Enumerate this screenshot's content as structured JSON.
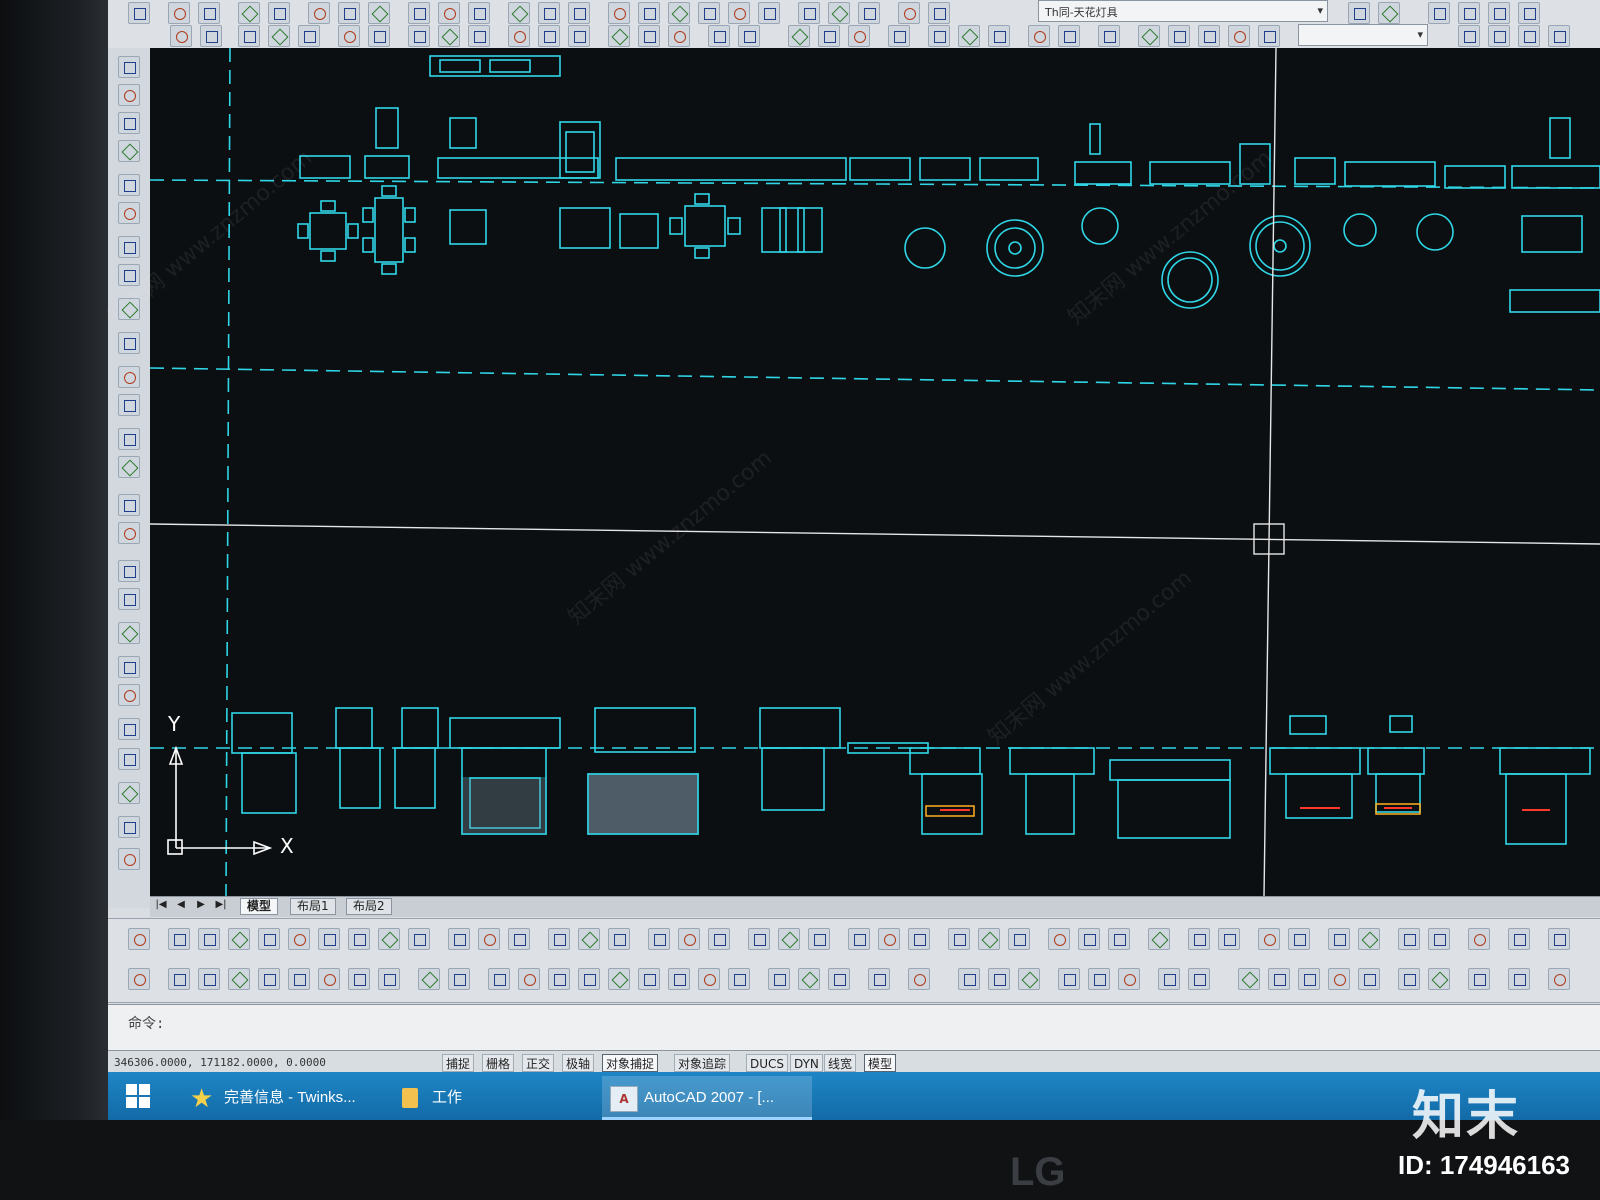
{
  "top_toolbar": {
    "layer_combo_text": "Th同-天花灯具"
  },
  "layout_tabs": {
    "nav_first": "|◀",
    "nav_prev": "◀",
    "nav_next": "▶",
    "nav_last": "▶|",
    "items": [
      {
        "label": "模型"
      },
      {
        "label": "布局1"
      },
      {
        "label": "布局2"
      }
    ]
  },
  "ucs": {
    "y_label": "Y",
    "x_label": "X"
  },
  "command": {
    "prompt": "命令:"
  },
  "status_bar": {
    "coordinates": "346306.0000, 171182.0000, 0.0000",
    "buttons": [
      {
        "label": "捕捉",
        "on": false
      },
      {
        "label": "栅格",
        "on": false
      },
      {
        "label": "正交",
        "on": false
      },
      {
        "label": "极轴",
        "on": false
      },
      {
        "label": "对象捕捉",
        "on": true
      },
      {
        "label": "对象追踪",
        "on": false
      },
      {
        "label": "DUCS",
        "on": false
      },
      {
        "label": "DYN",
        "on": false
      },
      {
        "label": "线宽",
        "on": false
      },
      {
        "label": "模型",
        "on": true
      }
    ]
  },
  "taskbar": {
    "items": [
      {
        "label": "完善信息 - Twinks..."
      },
      {
        "label": "工作"
      },
      {
        "label": "AutoCAD 2007 - [..."
      }
    ]
  },
  "watermark": {
    "brand": "知末",
    "id_text": "ID: 174946163",
    "repeated_text": "知末网 www.znzmo.com"
  },
  "monitor": {
    "brand": "LG"
  },
  "colors": {
    "cad_lines": "#2fd6e6",
    "cad_background": "#0c0f12",
    "crosshair": "#e6e6e6",
    "taskbar": "#1478b8"
  }
}
